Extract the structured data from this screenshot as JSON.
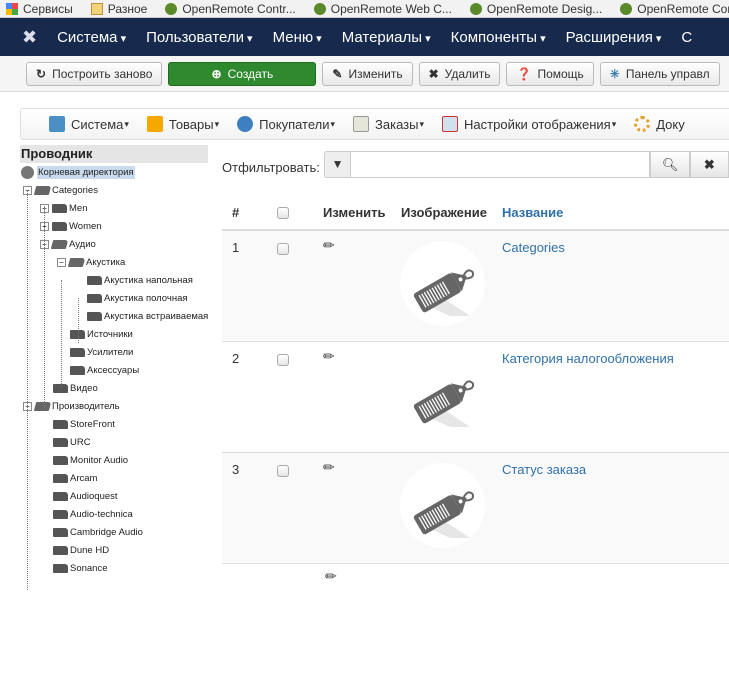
{
  "bookmarks": [
    "Сервисы",
    "Разное",
    "OpenRemote Contr...",
    "OpenRemote Web C...",
    "OpenRemote Desig...",
    "OpenRemote Cont"
  ],
  "nav": [
    "Система",
    "Пользователи",
    "Меню",
    "Материалы",
    "Компоненты",
    "Расширения",
    "С"
  ],
  "toolbar": {
    "rebuild": "Построить заново",
    "create": "Создать",
    "edit": "Изменить",
    "delete": "Удалить",
    "help": "Помощь",
    "panel": "Панель управл"
  },
  "submenu": [
    "Система",
    "Товары",
    "Покупатели",
    "Заказы",
    "Настройки отображения",
    "Доку"
  ],
  "sidebar": {
    "title": "Проводник",
    "root": "Корневая директория",
    "tree": [
      {
        "label": "Categories",
        "level": 1,
        "toggle": "-",
        "open": true
      },
      {
        "label": "Men",
        "level": 2,
        "toggle": "+"
      },
      {
        "label": "Women",
        "level": 2,
        "toggle": "+"
      },
      {
        "label": "Аудио",
        "level": 2,
        "toggle": "-",
        "open": true
      },
      {
        "label": "Акустика",
        "level": 3,
        "toggle": "-",
        "open": true
      },
      {
        "label": "Акустика напольная",
        "level": 4
      },
      {
        "label": "Акустика полочная",
        "level": 4
      },
      {
        "label": "Акустика встраиваемая",
        "level": 4
      },
      {
        "label": "Источники",
        "level": 3
      },
      {
        "label": "Усилители",
        "level": 3
      },
      {
        "label": "Аксессуары",
        "level": 3
      },
      {
        "label": "Видео",
        "level": 2
      },
      {
        "label": "Производитель",
        "level": 1,
        "toggle": "-",
        "open": true
      },
      {
        "label": "StoreFront",
        "level": 2
      },
      {
        "label": "URC",
        "level": 2
      },
      {
        "label": "Monitor Audio",
        "level": 2
      },
      {
        "label": "Arcam",
        "level": 2
      },
      {
        "label": "Audioquest",
        "level": 2
      },
      {
        "label": "Audio-technica",
        "level": 2
      },
      {
        "label": "Cambridge Audio",
        "level": 2
      },
      {
        "label": "Dune HD",
        "level": 2
      },
      {
        "label": "Sonance",
        "level": 2
      }
    ]
  },
  "filter": {
    "label": "Отфильтровать:",
    "value": ""
  },
  "table": {
    "headers": {
      "num": "#",
      "edit": "Изменить",
      "image": "Изображение",
      "name": "Название"
    },
    "rows": [
      {
        "num": "1",
        "name": "Categories"
      },
      {
        "num": "2",
        "name": "Категория налогообложения"
      },
      {
        "num": "3",
        "name": "Статус заказа"
      }
    ]
  }
}
